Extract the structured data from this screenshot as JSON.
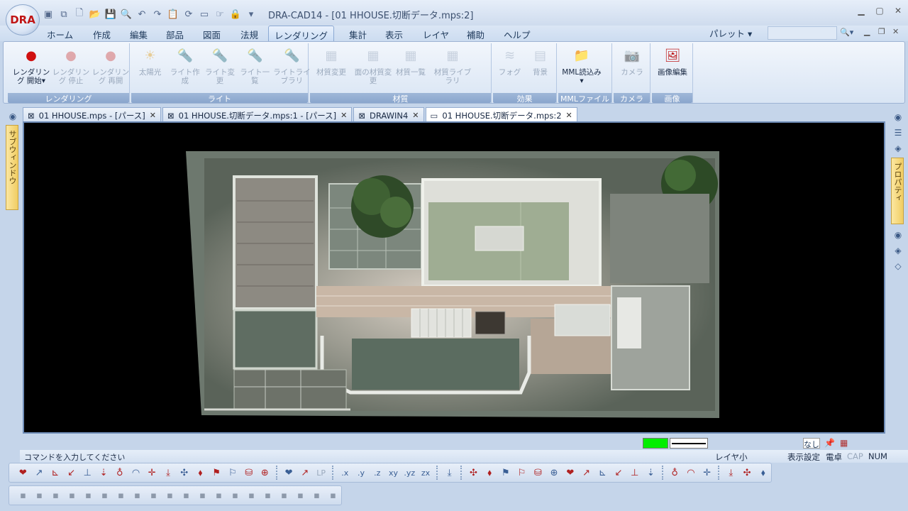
{
  "app": {
    "logo_text": "DRA",
    "title": "DRA-CAD14 - [01 HHOUSE.切断データ.mps:2]"
  },
  "qat_icons": [
    "2d3d-icon",
    "copy-doc-icon",
    "new-icon",
    "open-icon",
    "save-icon",
    "preview-icon",
    "undo-icon",
    "redo-icon",
    "clipboard-icon",
    "refresh-icon",
    "box-icon",
    "hand-icon",
    "lock-icon",
    "dropdown-icon"
  ],
  "menu": {
    "items": [
      "ホーム",
      "作成",
      "編集",
      "部品",
      "図面",
      "法規",
      "レンダリング",
      "集計",
      "表示",
      "レイヤ",
      "補助",
      "ヘルプ"
    ],
    "active": "レンダリング",
    "palette": "パレット ▾"
  },
  "ribbon": {
    "groups": [
      {
        "title": "レンダリング",
        "buttons": [
          {
            "label": "レンダリング 開始▾",
            "icon": "render-start-icon",
            "enabled": true
          },
          {
            "label": "レンダリング 停止",
            "icon": "render-stop-icon",
            "enabled": false
          },
          {
            "label": "レンダリング 再開",
            "icon": "render-resume-icon",
            "enabled": false
          }
        ]
      },
      {
        "title": "ライト",
        "buttons": [
          {
            "label": "太陽光",
            "icon": "sun-icon",
            "enabled": false
          },
          {
            "label": "ライト作成",
            "icon": "light-create-icon",
            "enabled": false
          },
          {
            "label": "ライト変更",
            "icon": "light-change-icon",
            "enabled": false
          },
          {
            "label": "ライト一覧",
            "icon": "light-list-icon",
            "enabled": false
          },
          {
            "label": "ライトライブラリ",
            "icon": "light-library-icon",
            "enabled": false
          }
        ]
      },
      {
        "title": "材質",
        "buttons": [
          {
            "label": "材質変更",
            "icon": "material-change-icon",
            "enabled": false
          },
          {
            "label": "面の材質変更",
            "icon": "face-material-icon",
            "enabled": false
          },
          {
            "label": "材質一覧",
            "icon": "material-list-icon",
            "enabled": false
          },
          {
            "label": "材質ライブラリ",
            "icon": "material-library-icon",
            "enabled": false
          }
        ]
      },
      {
        "title": "効果",
        "buttons": [
          {
            "label": "フォグ",
            "icon": "fog-icon",
            "enabled": false
          },
          {
            "label": "背景",
            "icon": "background-icon",
            "enabled": false
          }
        ]
      },
      {
        "title": "MMLファイル",
        "buttons": [
          {
            "label": "MML読込み▾",
            "icon": "mml-load-icon",
            "enabled": true
          }
        ]
      },
      {
        "title": "カメラ",
        "buttons": [
          {
            "label": "カメラ",
            "icon": "camera-icon",
            "enabled": false
          }
        ]
      },
      {
        "title": "画像",
        "buttons": [
          {
            "label": "画像編集",
            "icon": "image-edit-icon",
            "enabled": true
          }
        ]
      }
    ]
  },
  "tabs": [
    {
      "label": "01 HHOUSE.mps - [パース]",
      "active": false
    },
    {
      "label": "01 HHOUSE.切断データ.mps:1 - [パース]",
      "active": false
    },
    {
      "label": "DRAWIN4",
      "active": false
    },
    {
      "label": "01 HHOUSE.切断データ.mps:2",
      "active": true
    }
  ],
  "side": {
    "left_label": "サブウィンドウ",
    "right_label": "プロパティ"
  },
  "status": {
    "layer_none": "なし",
    "command_prompt": "コマンドを入力してください",
    "layer_small": "レイヤ小",
    "display_settings": "表示設定",
    "calculator": "電卓",
    "cap": "CAP",
    "num": "NUM",
    "current_color": "#00ee00"
  },
  "toolbar1_icons": [
    "pin-icon",
    "line-icon",
    "angle-icon",
    "arrow-icon",
    "perp-icon",
    "drop-icon",
    "circle-point-icon",
    "arc-icon",
    "target-icon",
    "cross-icon",
    "tri-icon",
    "dist-icon",
    "node-icon",
    "flag-icon",
    "stamp-icon",
    "grid-icon",
    "sep",
    "snap-icon",
    "star-icon",
    "lp-icon",
    "sep",
    "x-icon",
    "y-icon",
    "z-icon",
    "xy-icon",
    "yz-icon",
    "zx-icon",
    "sep",
    "swap-icon",
    "sep",
    "select-all-icon",
    "pick-icon",
    "rect-icon",
    "box-select-icon",
    "split-icon",
    "tree-icon",
    "filter-icon",
    "lasso-icon",
    "hatch-icon",
    "bars-icon",
    "layers-icon",
    "fill-icon",
    "sep",
    "group-icon",
    "ungroup-icon",
    "menu-icon",
    "sep",
    "rotate-icon",
    "copy-win-icon",
    "props-icon"
  ],
  "toolbar1_labels": {
    "x-icon": ".x",
    "y-icon": ".y",
    "z-icon": ".z",
    "xy-icon": "xy",
    "yz-icon": ".yz",
    "zx-icon": "zx",
    "lp-icon": "LP"
  },
  "toolbar2_icons": [
    "t2-a-icon",
    "t2-b-icon",
    "t2-c-icon",
    "t2-d-icon",
    "t2-e-icon",
    "t2-f-icon",
    "t2-g-icon",
    "t2-h-icon",
    "t2-i-icon",
    "t2-j-icon",
    "t2-k-icon",
    "t2-l-icon",
    "t2-m-icon",
    "t2-n-icon",
    "t2-o-icon",
    "t2-p-icon",
    "t2-q-icon",
    "t2-r-icon",
    "t2-s-icon",
    "t2-t-icon"
  ]
}
